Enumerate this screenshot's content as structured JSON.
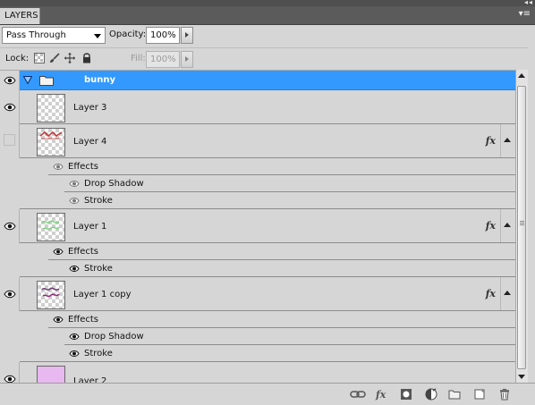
{
  "panel": {
    "tab_label": "LAYERS",
    "menu_glyph": "▾≡",
    "collapse_glyph": "◂◂"
  },
  "blend": {
    "mode": "Pass Through",
    "opacity_label": "Opacity:",
    "opacity_value": "100%"
  },
  "lock": {
    "label": "Lock:",
    "fill_label": "Fill:",
    "fill_value": "100%"
  },
  "icons": {
    "lock": [
      "lock-transparent-icon",
      "lock-brush-icon",
      "lock-move-icon",
      "lock-all-icon"
    ],
    "bottom": [
      "link-layers-icon",
      "add-style-icon",
      "add-mask-icon",
      "adjustment-layer-icon",
      "new-group-icon",
      "new-layer-icon",
      "delete-layer-icon"
    ]
  },
  "group": {
    "name": "bunny",
    "visible": true,
    "expanded": true,
    "selected": true,
    "highlight_color": "#3399ff"
  },
  "layers": [
    {
      "name": "Layer 3",
      "visible": true,
      "fx": false,
      "thumb": "transparent"
    },
    {
      "name": "Layer 4",
      "visible": false,
      "fx": true,
      "fx_label": "fx",
      "thumb": "red-text",
      "effects": {
        "label": "Effects",
        "items": [
          "Drop Shadow",
          "Stroke"
        ]
      }
    },
    {
      "name": "Layer 1",
      "visible": true,
      "fx": true,
      "fx_label": "fx",
      "thumb": "green-text",
      "effects": {
        "label": "Effects",
        "items": [
          "Stroke"
        ]
      }
    },
    {
      "name": "Layer 1 copy",
      "visible": true,
      "fx": true,
      "fx_label": "fx",
      "thumb": "purple-text",
      "effects": {
        "label": "Effects",
        "items": [
          "Drop Shadow",
          "Stroke"
        ]
      }
    },
    {
      "name": "Layer 2",
      "visible": true,
      "fx": false,
      "thumb": "lavender-fill",
      "thumb_color": "#e8b8f0"
    }
  ]
}
